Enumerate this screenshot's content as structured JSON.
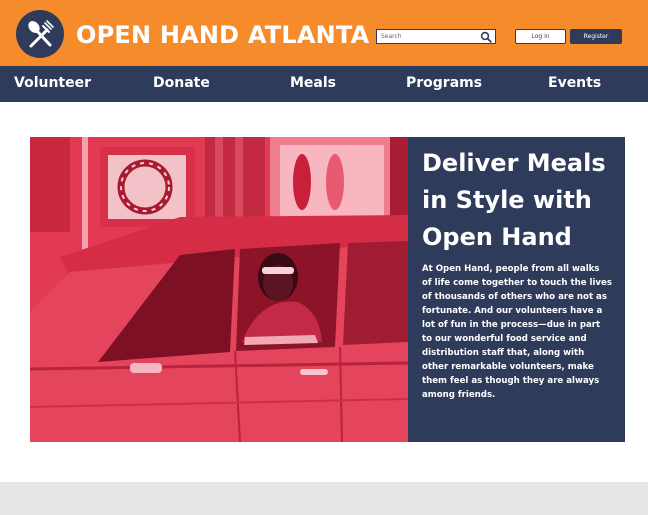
{
  "colors": {
    "header_orange": "#f68b2c",
    "navy": "#2e3b5b",
    "photo_red": "#e23a52",
    "footer_gray": "#e5e5e5"
  },
  "header": {
    "logo_icon": "fork-spoon-icon",
    "brand": "OPEN HAND ATLANTA",
    "search_placeholder": "Search",
    "search_icon": "search-icon",
    "login_label": "Log in",
    "register_label": "Register"
  },
  "nav": {
    "items": [
      {
        "label": "Volunteer"
      },
      {
        "label": "Donate"
      },
      {
        "label": "Meals"
      },
      {
        "label": "Programs"
      },
      {
        "label": "Events"
      }
    ]
  },
  "hero": {
    "title": "Deliver Meals in Style with Open Hand",
    "body": "At Open Hand, people from all walks of life come together to touch the lives of thousands of others who are not as fortunate. And our volunteers have a lot of fun in the process—due in part to our wonderful food service and distribution staff that, along with other remarkable volunteers, make them feel as though they are always among friends."
  }
}
